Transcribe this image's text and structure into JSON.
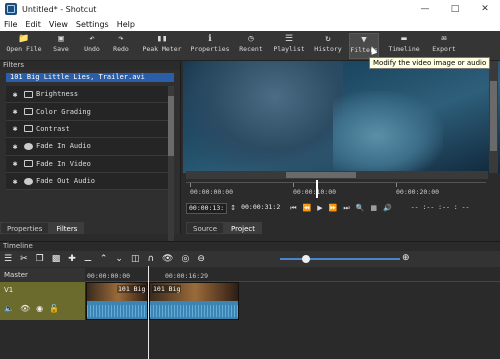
{
  "window": {
    "title": "Untitled* - Shotcut"
  },
  "menu": [
    "File",
    "Edit",
    "View",
    "Settings",
    "Help"
  ],
  "toolbar": [
    {
      "label": "Open File",
      "icon": "folder-icon"
    },
    {
      "label": "Save",
      "icon": "save-icon"
    },
    {
      "label": "Undo",
      "icon": "undo-icon"
    },
    {
      "label": "Redo",
      "icon": "redo-icon"
    },
    {
      "label": "Peak Meter",
      "icon": "meter-icon"
    },
    {
      "label": "Properties",
      "icon": "info-icon"
    },
    {
      "label": "Recent",
      "icon": "clock-icon"
    },
    {
      "label": "Playlist",
      "icon": "list-icon"
    },
    {
      "label": "History",
      "icon": "history-icon"
    },
    {
      "label": "Filters",
      "icon": "funnel-icon"
    },
    {
      "label": "Timeline",
      "icon": "timeline-icon"
    },
    {
      "label": "Export",
      "icon": "export-icon"
    }
  ],
  "tooltip": "Modify the video image or audio",
  "filters_panel": {
    "title": "Filters",
    "clip": "101 Big Little Lies, Trailer.avi",
    "items": [
      {
        "label": "Brightness",
        "type": "video"
      },
      {
        "label": "Color Grading",
        "type": "video"
      },
      {
        "label": "Contrast",
        "type": "video"
      },
      {
        "label": "Fade In Audio",
        "type": "audio"
      },
      {
        "label": "Fade In Video",
        "type": "video"
      },
      {
        "label": "Fade Out Audio",
        "type": "audio"
      }
    ]
  },
  "left_tabs": [
    "Properties",
    "Filters"
  ],
  "right_tabs": [
    "Source",
    "Project"
  ],
  "player": {
    "ruler_ticks": [
      "00:00:00:00",
      "00:00:10:00",
      "00:00:20:00"
    ],
    "position": "00:00:13:",
    "duration": "00:00:31:2",
    "in_out": "-- :-- :-- : --"
  },
  "timeline": {
    "title": "Timeline",
    "master_label": "Master",
    "track_name": "V1",
    "ruler_ticks": [
      "00:00:00:00",
      "00:00:16:29"
    ],
    "clip_label_1": "101 Big",
    "clip_label_2": "101 Big"
  }
}
